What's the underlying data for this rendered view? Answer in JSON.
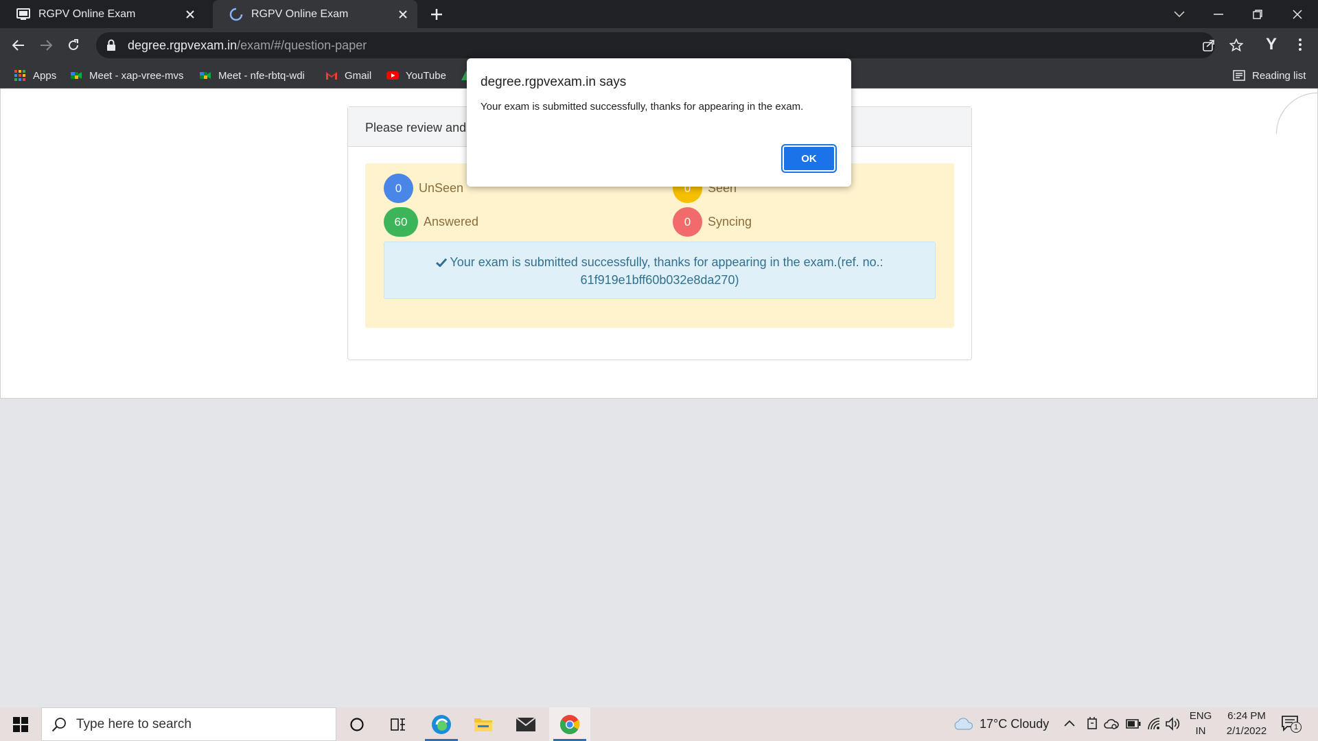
{
  "browser": {
    "tabs": [
      {
        "title": "RGPV Online Exam",
        "active": false
      },
      {
        "title": "RGPV Online Exam",
        "active": true
      }
    ],
    "url_host": "degree.rgpvexam.in",
    "url_path": "/exam/#/question-paper",
    "profile_initial": "Y",
    "bookmarks": [
      {
        "label": "Apps",
        "icon": "apps-grid-icon"
      },
      {
        "label": "Meet - xap-vree-mvs",
        "icon": "google-meet-icon"
      },
      {
        "label": "Meet - nfe-rbtq-wdi",
        "icon": "google-meet-icon"
      },
      {
        "label": "Gmail",
        "icon": "gmail-icon"
      },
      {
        "label": "YouTube",
        "icon": "youtube-icon"
      }
    ],
    "reading_list": "Reading list"
  },
  "dialog": {
    "title": "degree.rgpvexam.in says",
    "message": "Your exam is submitted successfully, thanks for appearing in the exam.",
    "ok_label": "OK"
  },
  "exam": {
    "header": "Please review and c",
    "stats": [
      {
        "count": "0",
        "label": "UnSeen",
        "color": "#4a86e8"
      },
      {
        "count": "0",
        "label": "Seen",
        "color": "#f5c000"
      },
      {
        "count": "60",
        "label": "Answered",
        "color": "#3cb55a"
      },
      {
        "count": "0",
        "label": "Syncing",
        "color": "#f26b6b"
      }
    ],
    "success_line1": "Your exam is submitted successfully, thanks for appearing in the exam.(ref. no.:",
    "success_line2": "61f919e1bff60b032e8da270)"
  },
  "taskbar": {
    "search_placeholder": "Type here to search",
    "weather": "17°C  Cloudy",
    "lang_top": "ENG",
    "lang_bottom": "IN",
    "time": "6:24 PM",
    "date": "2/1/2022",
    "notification_count": "1"
  }
}
